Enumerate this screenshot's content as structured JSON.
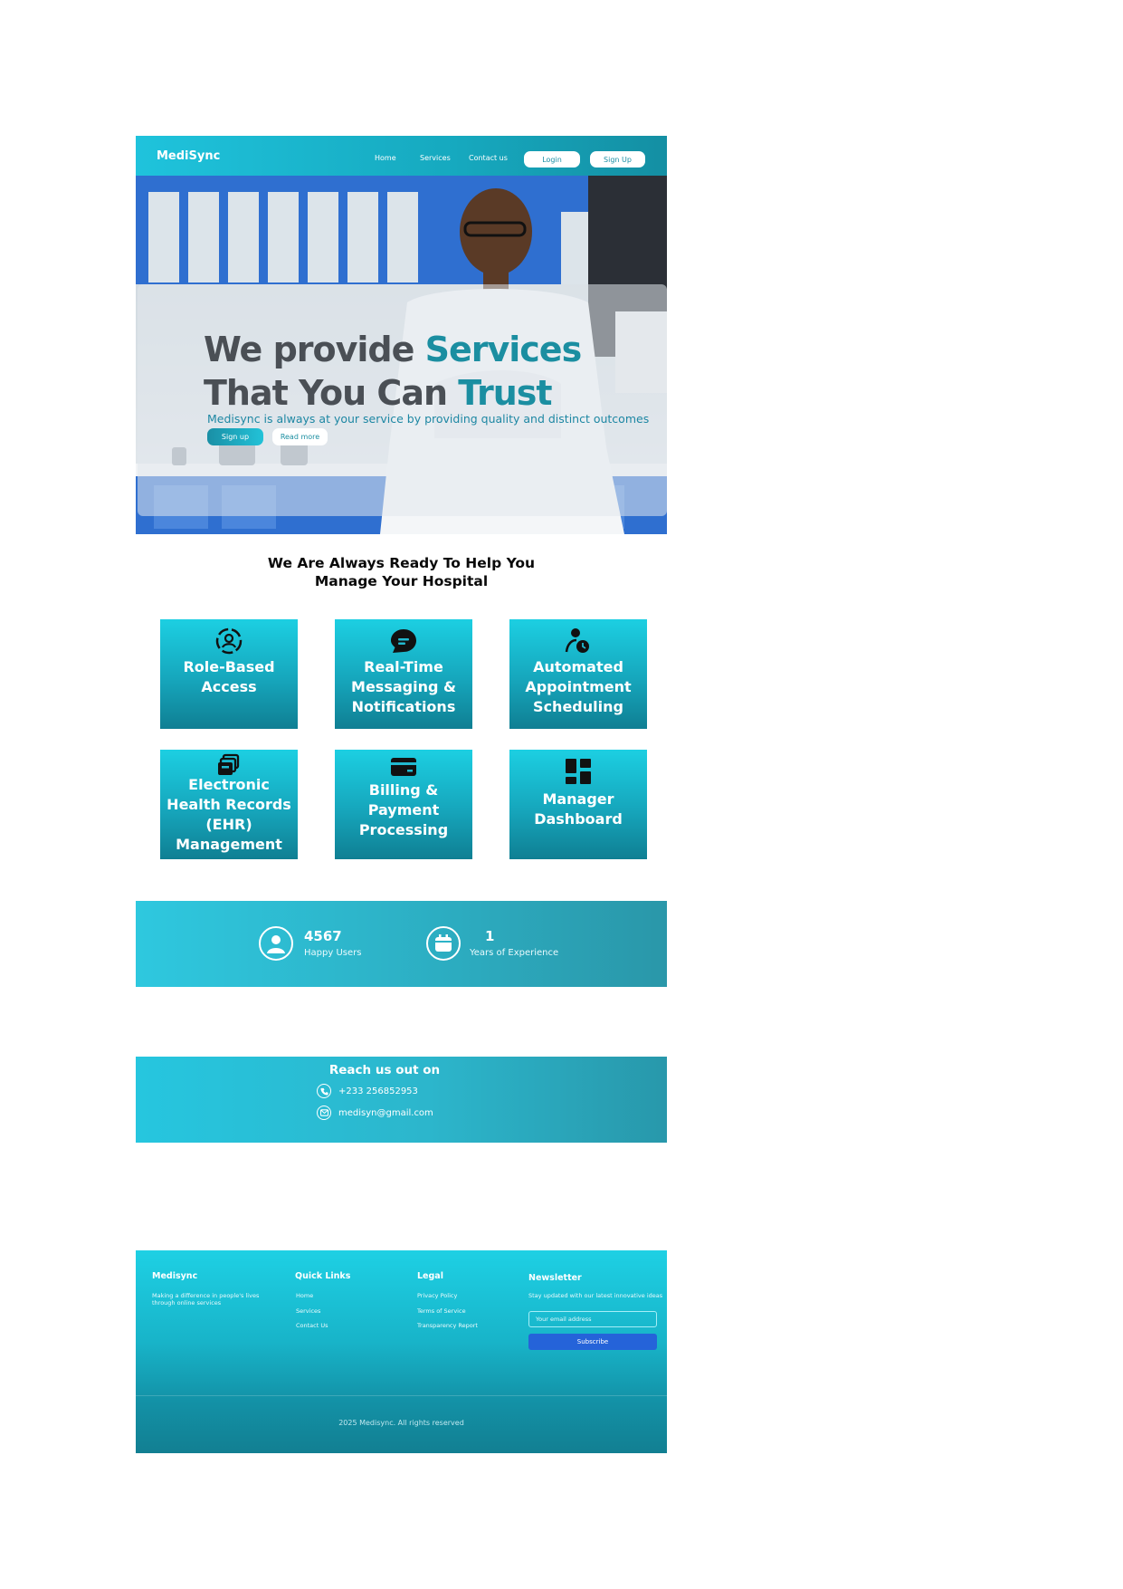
{
  "nav": {
    "brand": "MediSync",
    "links": [
      "Home",
      "Services",
      "Contact us"
    ],
    "login_label": "Login",
    "signup_label": "Sign Up"
  },
  "hero": {
    "title_line1_plain": "We provide ",
    "title_line1_accent": "Services",
    "title_line2_plain": "That You Can ",
    "title_line2_accent": "Trust",
    "subtitle": "Medisync is always at your service by providing quality and distinct outcomes",
    "signup_label": "Sign up",
    "readmore_label": "Read more"
  },
  "help": {
    "line1": "We  Are Always Ready  To Help You",
    "line2": "Manage Your Hospital"
  },
  "features": [
    {
      "icon": "role-access-icon",
      "lines": [
        "Role-Based",
        "Access"
      ]
    },
    {
      "icon": "chat-bubble-icon",
      "lines": [
        "Real-Time",
        "Messaging &",
        "Notifications"
      ]
    },
    {
      "icon": "person-clock-icon",
      "lines": [
        "Automated",
        "Appointment",
        "Scheduling"
      ]
    },
    {
      "icon": "records-stack-icon",
      "lines": [
        "Electronic",
        "Health Records",
        "(EHR)",
        "Management"
      ]
    },
    {
      "icon": "credit-card-icon",
      "lines": [
        "Billing &",
        "Payment",
        "Processing"
      ]
    },
    {
      "icon": "dashboard-icon",
      "lines": [
        "Manager",
        "Dashboard"
      ]
    }
  ],
  "stats": [
    {
      "icon": "user-icon",
      "value": "4567",
      "label": "Happy Users"
    },
    {
      "icon": "calendar-icon",
      "value": "1",
      "label": "Years of Experience"
    }
  ],
  "contact": {
    "title": "Reach us out on",
    "phone": "+233 256852953",
    "email": "medisyn@gmail.com"
  },
  "footer": {
    "brand": "Medisync",
    "tagline": "Making a difference in people's lives through online services",
    "quick_links_title": "Quick Links",
    "quick_links": [
      "Home",
      "Services",
      "Contact Us"
    ],
    "legal_title": "Legal",
    "legal_links": [
      "Privacy Policy",
      "Terms of Service",
      "Transparency Report"
    ],
    "newsletter_title": "Newsletter",
    "newsletter_text": "Stay updated with our latest innovative ideas",
    "email_placeholder": "Your email address",
    "subscribe_label": "Subscribe",
    "copyright": "2025 Medisync. All rights reserved"
  },
  "colors": {
    "brand_teal": "#16a9bf",
    "accent_teal": "#1b8ea1",
    "subscribe_blue": "#2563d9"
  }
}
